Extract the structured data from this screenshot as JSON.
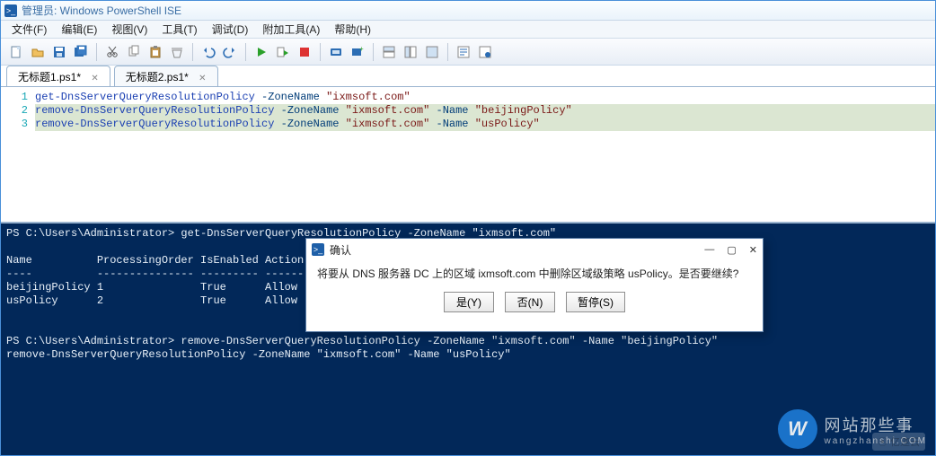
{
  "window": {
    "title": "管理员: Windows PowerShell ISE"
  },
  "menu": {
    "file": "文件(F)",
    "edit": "编辑(E)",
    "view": "视图(V)",
    "tools": "工具(T)",
    "debug": "调试(D)",
    "addons": "附加工具(A)",
    "help": "帮助(H)"
  },
  "tabs": [
    {
      "label": "无标题1.ps1*",
      "active": true
    },
    {
      "label": "无标题2.ps1*",
      "active": false
    }
  ],
  "editor": {
    "gutter": [
      "1",
      "2",
      "3"
    ],
    "lines": [
      {
        "selected": false,
        "tokens": [
          {
            "t": "get-DnsServerQueryResolutionPolicy",
            "c": "cmd"
          },
          {
            "t": " ",
            "c": ""
          },
          {
            "t": "-ZoneName",
            "c": "param"
          },
          {
            "t": " ",
            "c": ""
          },
          {
            "t": "\"ixmsoft.com\"",
            "c": "str"
          }
        ]
      },
      {
        "selected": true,
        "tokens": [
          {
            "t": "remove-DnsServerQueryResolutionPolicy",
            "c": "cmd"
          },
          {
            "t": " ",
            "c": ""
          },
          {
            "t": "-ZoneName",
            "c": "param"
          },
          {
            "t": " ",
            "c": ""
          },
          {
            "t": "\"ixmsoft.com\"",
            "c": "str"
          },
          {
            "t": " ",
            "c": ""
          },
          {
            "t": "-Name",
            "c": "param"
          },
          {
            "t": " ",
            "c": ""
          },
          {
            "t": "\"beijingPolicy\"",
            "c": "str"
          }
        ]
      },
      {
        "selected": true,
        "tokens": [
          {
            "t": "remove-DnsServerQueryResolutionPolicy",
            "c": "cmd"
          },
          {
            "t": " ",
            "c": ""
          },
          {
            "t": "-ZoneName",
            "c": "param"
          },
          {
            "t": " ",
            "c": ""
          },
          {
            "t": "\"ixmsoft.com\"",
            "c": "str"
          },
          {
            "t": " ",
            "c": ""
          },
          {
            "t": "-Name",
            "c": "param"
          },
          {
            "t": " ",
            "c": ""
          },
          {
            "t": "\"usPolicy\"",
            "c": "str"
          }
        ]
      }
    ]
  },
  "console": {
    "lines": [
      "PS C:\\Users\\Administrator> get-DnsServerQueryResolutionPolicy -ZoneName \"ixmsoft.com\"",
      "",
      "Name          ProcessingOrder IsEnabled Action",
      "----          --------------- --------- ------",
      "beijingPolicy 1               True      Allow",
      "usPolicy      2               True      Allow",
      "",
      "",
      "PS C:\\Users\\Administrator> remove-DnsServerQueryResolutionPolicy -ZoneName \"ixmsoft.com\" -Name \"beijingPolicy\"",
      "remove-DnsServerQueryResolutionPolicy -ZoneName \"ixmsoft.com\" -Name \"usPolicy\""
    ]
  },
  "dialog": {
    "title": "确认",
    "message": "将要从 DNS 服务器 DC 上的区域 ixmsoft.com 中删除区域级策略 usPolicy。是否要继续?",
    "yes": "是(Y)",
    "no": "否(N)",
    "suspend": "暂停(S)"
  },
  "branding": {
    "big": "网站那些事",
    "small": "wangzhanshi.COM",
    "w": "W",
    "yisu": "⦿ 亿速云"
  }
}
